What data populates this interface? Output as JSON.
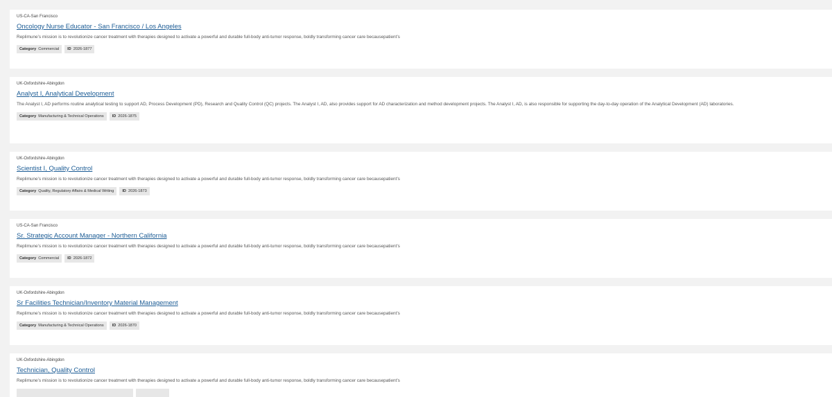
{
  "jobs": [
    {
      "location": "US-CA-San Francisco",
      "title": "Oncology Nurse Educator - San Francisco / Los Angeles",
      "description": "Replimune’s mission is to revolutionize cancer treatment with therapies designed to activate a powerful and durable full-body anti-tumor response, boldly transforming cancer care becausepatient’s",
      "category_label": "Category",
      "category": "Commercial",
      "id_label": "ID",
      "id": "2026-1877"
    },
    {
      "location": "UK-Oxfordshire-Abingdon",
      "title": "Analyst I, Analytical Development",
      "description": "The Analyst I, AD performs routine analytical testing to support AD, Process Development (PD), Research and Quality Control (QC) projects. The Analyst I, AD, also provides support for AD characterization and method development projects. The Analyst I, AD, is also responsible for supporting the day-to-day operation of the Analytical Development (AD) laboratories.",
      "category_label": "Category",
      "category": "Manufacturing & Technical Operations",
      "id_label": "ID",
      "id": "2026-1875"
    },
    {
      "location": "UK-Oxfordshire-Abingdon",
      "title": "Scientist I, Quality Control",
      "description": "Replimune’s mission is to revolutionize cancer treatment with therapies designed to activate a powerful and durable full-body anti-tumor response, boldly transforming cancer care becausepatient’s",
      "category_label": "Category",
      "category": "Quality, Regulatory Affairs & Medical Writing",
      "id_label": "ID",
      "id": "2026-1873"
    },
    {
      "location": "US-CA-San Francisco",
      "title": "Sr. Strategic Account Manager - Northern California",
      "description": "Replimune’s mission is to revolutionize cancer treatment with therapies designed to activate a powerful and durable full-body anti-tumor response, boldly transforming cancer care becausepatient’s",
      "category_label": "Category",
      "category": "Commercial",
      "id_label": "ID",
      "id": "2026-1872"
    },
    {
      "location": "UK-Oxfordshire-Abingdon",
      "title": "Sr Facilities Technician/Inventory Material Management",
      "description": "Replimune’s mission is to revolutionize cancer treatment with therapies designed to activate a powerful and durable full-body anti-tumor response, boldly transforming cancer care becausepatient’s",
      "category_label": "Category",
      "category": "Manufacturing & Technical Operations",
      "id_label": "ID",
      "id": "2026-1870"
    },
    {
      "location": "UK-Oxfordshire-Abingdon",
      "title": "Technician, Quality Control",
      "description": "Replimune’s mission is to revolutionize cancer treatment with therapies designed to activate a powerful and durable full-body anti-tumor response, boldly transforming cancer care becausepatient’s"
    }
  ]
}
